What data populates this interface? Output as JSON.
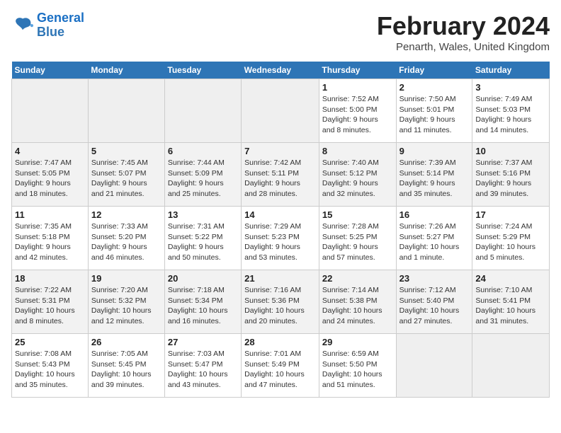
{
  "header": {
    "logo_line1": "General",
    "logo_line2": "Blue",
    "title": "February 2024",
    "subtitle": "Penarth, Wales, United Kingdom"
  },
  "weekdays": [
    "Sunday",
    "Monday",
    "Tuesday",
    "Wednesday",
    "Thursday",
    "Friday",
    "Saturday"
  ],
  "weeks": [
    [
      {
        "num": "",
        "info": ""
      },
      {
        "num": "",
        "info": ""
      },
      {
        "num": "",
        "info": ""
      },
      {
        "num": "",
        "info": ""
      },
      {
        "num": "1",
        "info": "Sunrise: 7:52 AM\nSunset: 5:00 PM\nDaylight: 9 hours\nand 8 minutes."
      },
      {
        "num": "2",
        "info": "Sunrise: 7:50 AM\nSunset: 5:01 PM\nDaylight: 9 hours\nand 11 minutes."
      },
      {
        "num": "3",
        "info": "Sunrise: 7:49 AM\nSunset: 5:03 PM\nDaylight: 9 hours\nand 14 minutes."
      }
    ],
    [
      {
        "num": "4",
        "info": "Sunrise: 7:47 AM\nSunset: 5:05 PM\nDaylight: 9 hours\nand 18 minutes."
      },
      {
        "num": "5",
        "info": "Sunrise: 7:45 AM\nSunset: 5:07 PM\nDaylight: 9 hours\nand 21 minutes."
      },
      {
        "num": "6",
        "info": "Sunrise: 7:44 AM\nSunset: 5:09 PM\nDaylight: 9 hours\nand 25 minutes."
      },
      {
        "num": "7",
        "info": "Sunrise: 7:42 AM\nSunset: 5:11 PM\nDaylight: 9 hours\nand 28 minutes."
      },
      {
        "num": "8",
        "info": "Sunrise: 7:40 AM\nSunset: 5:12 PM\nDaylight: 9 hours\nand 32 minutes."
      },
      {
        "num": "9",
        "info": "Sunrise: 7:39 AM\nSunset: 5:14 PM\nDaylight: 9 hours\nand 35 minutes."
      },
      {
        "num": "10",
        "info": "Sunrise: 7:37 AM\nSunset: 5:16 PM\nDaylight: 9 hours\nand 39 minutes."
      }
    ],
    [
      {
        "num": "11",
        "info": "Sunrise: 7:35 AM\nSunset: 5:18 PM\nDaylight: 9 hours\nand 42 minutes."
      },
      {
        "num": "12",
        "info": "Sunrise: 7:33 AM\nSunset: 5:20 PM\nDaylight: 9 hours\nand 46 minutes."
      },
      {
        "num": "13",
        "info": "Sunrise: 7:31 AM\nSunset: 5:22 PM\nDaylight: 9 hours\nand 50 minutes."
      },
      {
        "num": "14",
        "info": "Sunrise: 7:29 AM\nSunset: 5:23 PM\nDaylight: 9 hours\nand 53 minutes."
      },
      {
        "num": "15",
        "info": "Sunrise: 7:28 AM\nSunset: 5:25 PM\nDaylight: 9 hours\nand 57 minutes."
      },
      {
        "num": "16",
        "info": "Sunrise: 7:26 AM\nSunset: 5:27 PM\nDaylight: 10 hours\nand 1 minute."
      },
      {
        "num": "17",
        "info": "Sunrise: 7:24 AM\nSunset: 5:29 PM\nDaylight: 10 hours\nand 5 minutes."
      }
    ],
    [
      {
        "num": "18",
        "info": "Sunrise: 7:22 AM\nSunset: 5:31 PM\nDaylight: 10 hours\nand 8 minutes."
      },
      {
        "num": "19",
        "info": "Sunrise: 7:20 AM\nSunset: 5:32 PM\nDaylight: 10 hours\nand 12 minutes."
      },
      {
        "num": "20",
        "info": "Sunrise: 7:18 AM\nSunset: 5:34 PM\nDaylight: 10 hours\nand 16 minutes."
      },
      {
        "num": "21",
        "info": "Sunrise: 7:16 AM\nSunset: 5:36 PM\nDaylight: 10 hours\nand 20 minutes."
      },
      {
        "num": "22",
        "info": "Sunrise: 7:14 AM\nSunset: 5:38 PM\nDaylight: 10 hours\nand 24 minutes."
      },
      {
        "num": "23",
        "info": "Sunrise: 7:12 AM\nSunset: 5:40 PM\nDaylight: 10 hours\nand 27 minutes."
      },
      {
        "num": "24",
        "info": "Sunrise: 7:10 AM\nSunset: 5:41 PM\nDaylight: 10 hours\nand 31 minutes."
      }
    ],
    [
      {
        "num": "25",
        "info": "Sunrise: 7:08 AM\nSunset: 5:43 PM\nDaylight: 10 hours\nand 35 minutes."
      },
      {
        "num": "26",
        "info": "Sunrise: 7:05 AM\nSunset: 5:45 PM\nDaylight: 10 hours\nand 39 minutes."
      },
      {
        "num": "27",
        "info": "Sunrise: 7:03 AM\nSunset: 5:47 PM\nDaylight: 10 hours\nand 43 minutes."
      },
      {
        "num": "28",
        "info": "Sunrise: 7:01 AM\nSunset: 5:49 PM\nDaylight: 10 hours\nand 47 minutes."
      },
      {
        "num": "29",
        "info": "Sunrise: 6:59 AM\nSunset: 5:50 PM\nDaylight: 10 hours\nand 51 minutes."
      },
      {
        "num": "",
        "info": ""
      },
      {
        "num": "",
        "info": ""
      }
    ]
  ]
}
